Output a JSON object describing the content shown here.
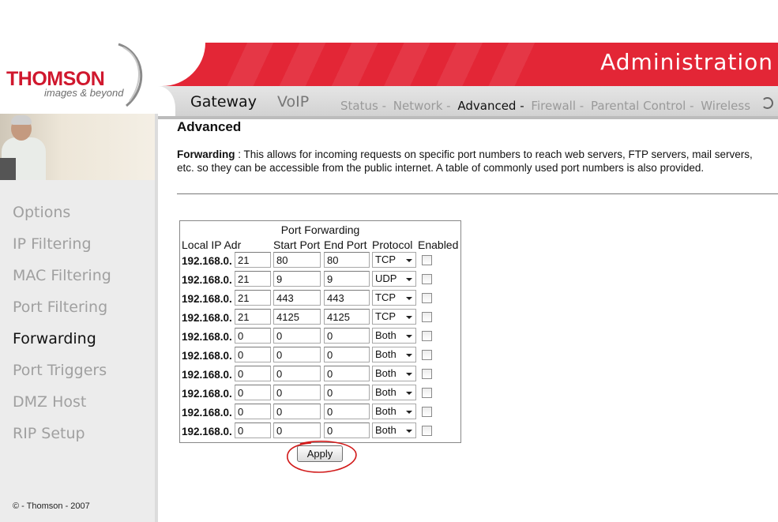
{
  "brand": {
    "name": "THOMSON",
    "tagline": "images & beyond"
  },
  "header": {
    "title": "Administration",
    "color": "#e32636"
  },
  "main_tabs": [
    {
      "label": "Gateway",
      "active": true
    },
    {
      "label": "VoIP",
      "active": false
    }
  ],
  "sub_nav": [
    {
      "label": "Status -",
      "active": false
    },
    {
      "label": "Network -",
      "active": false
    },
    {
      "label": "Advanced -",
      "active": true
    },
    {
      "label": "Firewall -",
      "active": false
    },
    {
      "label": "Parental Control -",
      "active": false
    },
    {
      "label": "Wireless",
      "active": false
    }
  ],
  "sidebar": {
    "items": [
      {
        "label": "Options",
        "active": false
      },
      {
        "label": "IP Filtering",
        "active": false
      },
      {
        "label": "MAC Filtering",
        "active": false
      },
      {
        "label": "Port Filtering",
        "active": false
      },
      {
        "label": "Forwarding",
        "active": true
      },
      {
        "label": "Port Triggers",
        "active": false
      },
      {
        "label": "DMZ Host",
        "active": false
      },
      {
        "label": "RIP Setup",
        "active": false
      }
    ],
    "copyright": "© - Thomson - 2007"
  },
  "content": {
    "title": "Advanced",
    "desc_label": "Forwarding",
    "desc_text": " :  This allows for incoming requests on specific port numbers to reach web servers, FTP servers, mail servers, etc. so they can be accessible from the public internet. A table of commonly used port numbers is also provided."
  },
  "table": {
    "caption": "Port Forwarding",
    "headers": {
      "ip": "Local IP Adr",
      "start": "Start Port",
      "end": "End Port",
      "protocol": "Protocol",
      "enabled": "Enabled"
    },
    "ip_prefix": "192.168.0.",
    "rows": [
      {
        "ip": "21",
        "start": "80",
        "end": "80",
        "protocol": "TCP"
      },
      {
        "ip": "21",
        "start": "9",
        "end": "9",
        "protocol": "UDP"
      },
      {
        "ip": "21",
        "start": "443",
        "end": "443",
        "protocol": "TCP"
      },
      {
        "ip": "21",
        "start": "4125",
        "end": "4125",
        "protocol": "TCP"
      },
      {
        "ip": "0",
        "start": "0",
        "end": "0",
        "protocol": "Both"
      },
      {
        "ip": "0",
        "start": "0",
        "end": "0",
        "protocol": "Both"
      },
      {
        "ip": "0",
        "start": "0",
        "end": "0",
        "protocol": "Both"
      },
      {
        "ip": "0",
        "start": "0",
        "end": "0",
        "protocol": "Both"
      },
      {
        "ip": "0",
        "start": "0",
        "end": "0",
        "protocol": "Both"
      },
      {
        "ip": "0",
        "start": "0",
        "end": "0",
        "protocol": "Both"
      }
    ]
  },
  "apply_label": "Apply"
}
